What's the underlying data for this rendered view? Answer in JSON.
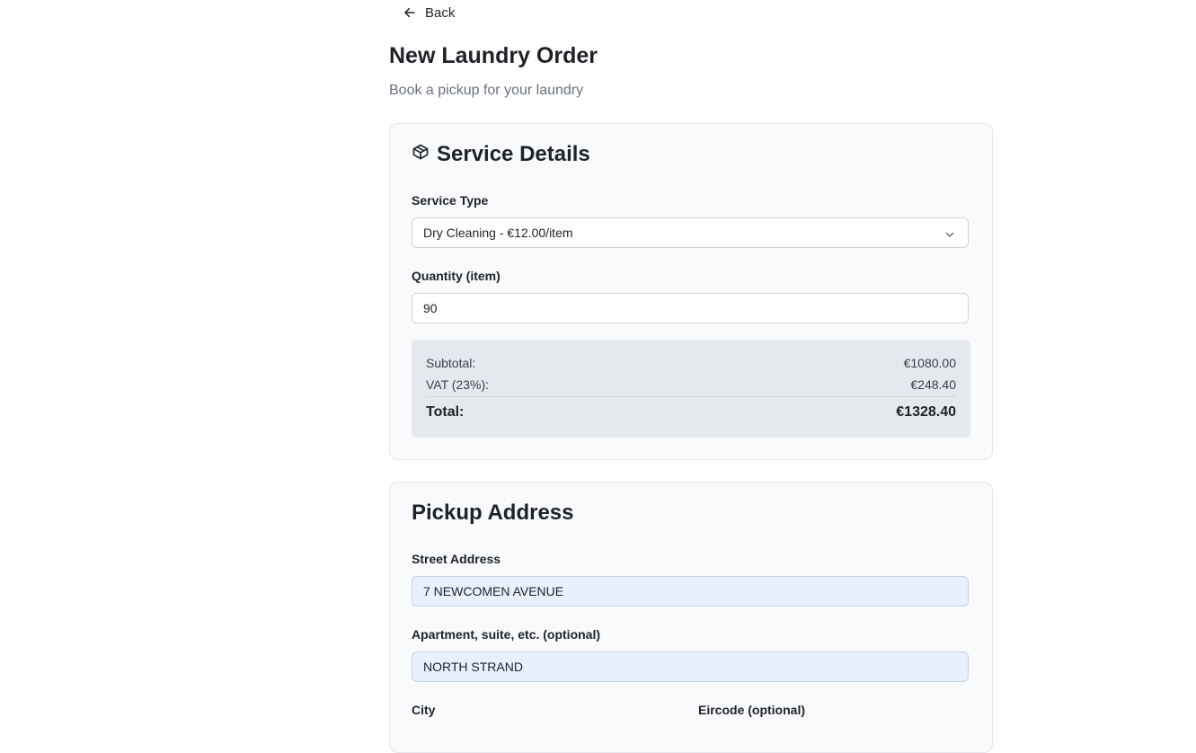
{
  "nav": {
    "back_label": "Back"
  },
  "header": {
    "title": "New Laundry Order",
    "subtitle": "Book a pickup for your laundry"
  },
  "service": {
    "heading": "Service Details",
    "icon": "package-icon",
    "service_type_label": "Service Type",
    "service_type_value": "Dry Cleaning - €12.00/item",
    "quantity_label": "Quantity (item)",
    "quantity_value": "90",
    "summary": {
      "subtotal_label": "Subtotal:",
      "subtotal_value": "€1080.00",
      "vat_label": "VAT (23%):",
      "vat_value": "€248.40",
      "total_label": "Total:",
      "total_value": "€1328.40"
    }
  },
  "address": {
    "heading": "Pickup Address",
    "street_label": "Street Address",
    "street_value": "7 NEWCOMEN AVENUE",
    "apartment_label": "Apartment, suite, etc. (optional)",
    "apartment_value": "NORTH STRAND",
    "city_label": "City",
    "eircode_label": "Eircode (optional)"
  },
  "colors": {
    "card_bg": "#f8fafc",
    "summary_bg": "#e5e8ec",
    "autofill_bg": "#e8effd",
    "muted_text": "#6b7280"
  }
}
